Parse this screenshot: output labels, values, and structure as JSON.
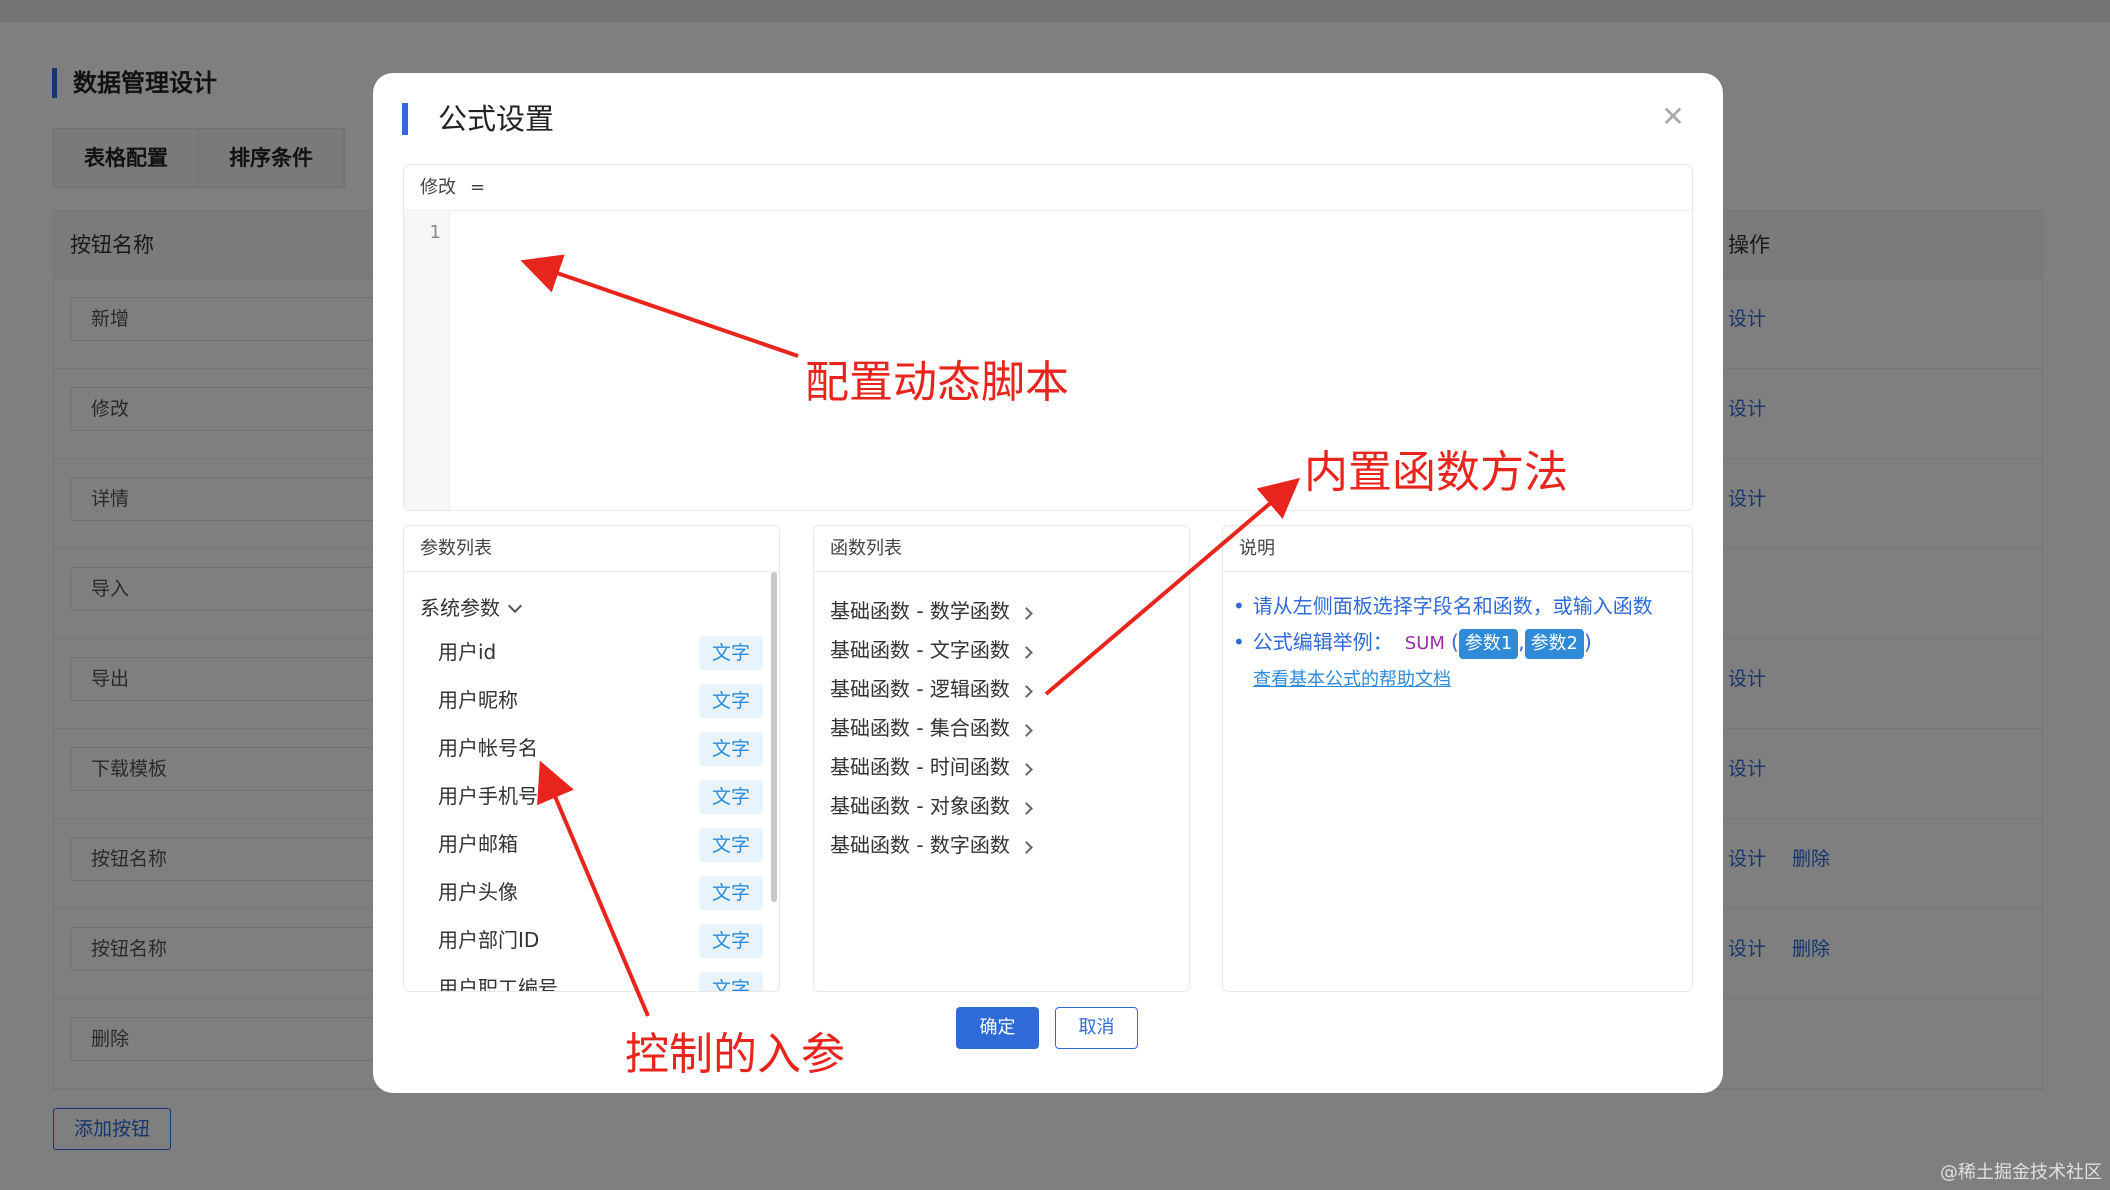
{
  "background": {
    "page_title": "数据管理设计",
    "tabs": [
      "表格配置",
      "排序条件"
    ],
    "table": {
      "col_name": "按钮名称",
      "col_ops": "操作",
      "rows": [
        {
          "value": "新增",
          "ops": [
            "设计"
          ]
        },
        {
          "value": "修改",
          "ops": [
            "设计"
          ]
        },
        {
          "value": "详情",
          "ops": [
            "设计"
          ]
        },
        {
          "value": "导入",
          "ops": []
        },
        {
          "value": "导出",
          "ops": [
            "设计"
          ]
        },
        {
          "value": "下载模板",
          "ops": [
            "设计"
          ]
        },
        {
          "value": "按钮名称",
          "ops": [
            "设计",
            "删除"
          ]
        },
        {
          "value": "按钮名称",
          "ops": [
            "设计",
            "删除"
          ]
        },
        {
          "value": "删除",
          "ops": []
        }
      ]
    },
    "add_button": "添加按钮"
  },
  "dialog": {
    "title": "公式设置",
    "close_icon": "close-icon",
    "editor": {
      "field_label": "修改",
      "operator": "=",
      "line_number": "1"
    },
    "params_panel": {
      "title": "参数列表",
      "group": "系统参数",
      "items": [
        {
          "name": "用户id",
          "type": "文字"
        },
        {
          "name": "用户昵称",
          "type": "文字"
        },
        {
          "name": "用户帐号名",
          "type": "文字"
        },
        {
          "name": "用户手机号",
          "type": "文字"
        },
        {
          "name": "用户邮箱",
          "type": "文字"
        },
        {
          "name": "用户头像",
          "type": "文字"
        },
        {
          "name": "用户部门ID",
          "type": "文字"
        },
        {
          "name": "用户职工编号",
          "type": "文字"
        }
      ]
    },
    "functions_panel": {
      "title": "函数列表",
      "items": [
        "基础函数 - 数学函数",
        "基础函数 - 文字函数",
        "基础函数 - 逻辑函数",
        "基础函数 - 集合函数",
        "基础函数 - 时间函数",
        "基础函数 - 对象函数",
        "基础函数 - 数字函数"
      ]
    },
    "description_panel": {
      "title": "说明",
      "line1": "请从左侧面板选择字段名和函数，或输入函数",
      "line2_label": "公式编辑举例：",
      "line2_func": "SUM",
      "line2_open": "(",
      "line2_param1": "参数1",
      "line2_comma": ",",
      "line2_param2": "参数2",
      "line2_close": ")",
      "help_link": "查看基本公式的帮助文档"
    },
    "ok_button": "确定",
    "cancel_button": "取消"
  },
  "annotations": {
    "script": "配置动态脚本",
    "functions": "内置函数方法",
    "params": "控制的入参"
  },
  "watermark": "@稀土掘金技术社区",
  "colors": {
    "primary": "#2f6bd8",
    "annotation": "#e8251c",
    "tag_bg": "#e9f3fb"
  }
}
